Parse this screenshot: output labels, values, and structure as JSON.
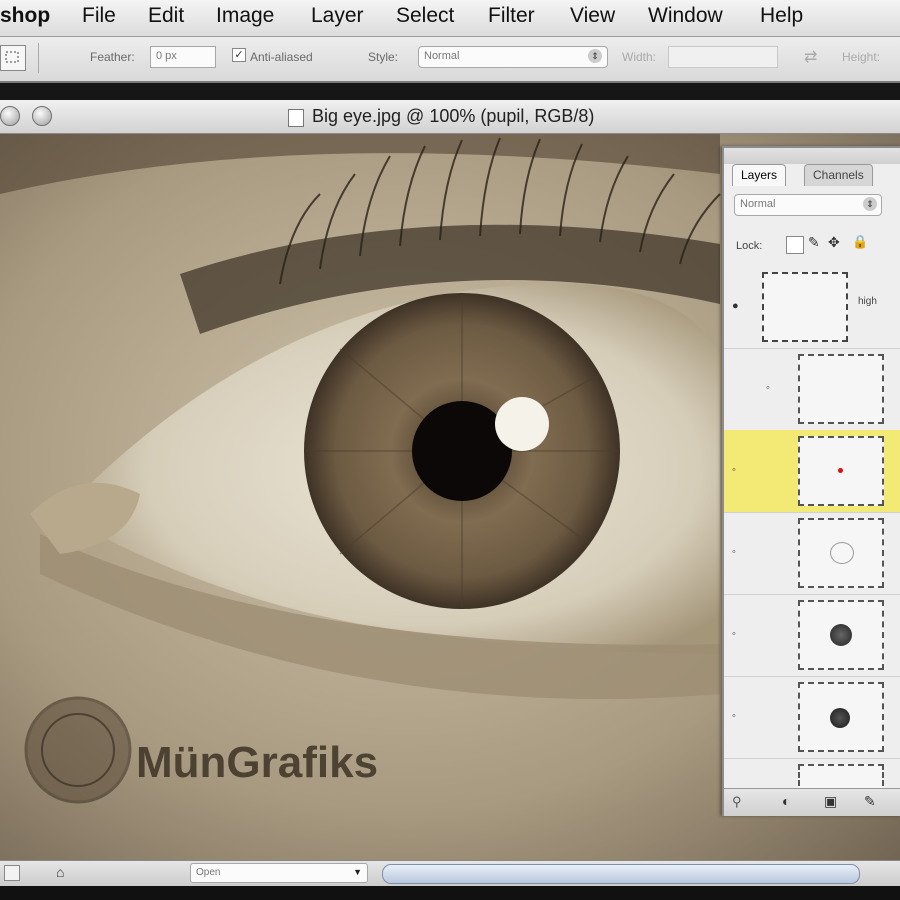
{
  "menu": {
    "app": "shop",
    "items": [
      "File",
      "Edit",
      "Image",
      "Layer",
      "Select",
      "Filter",
      "View",
      "Window",
      "Help"
    ]
  },
  "options": {
    "feather_label": "Feather:",
    "feather_value": "0 px",
    "antialiased_label": "Anti-aliased",
    "style_label": "Style:",
    "style_value": "Normal",
    "width_label": "Width:",
    "height_label": "Height:"
  },
  "document": {
    "title": "Big eye.jpg @ 100% (pupil, RGB/8)"
  },
  "watermark": {
    "text": "MünGrafiks"
  },
  "layers_panel": {
    "tabs": [
      "Layers",
      "Channels"
    ],
    "blend_mode": "Normal",
    "lock_label": "Lock:",
    "layers": [
      {
        "name": "high",
        "selected": false
      },
      {
        "name": "",
        "selected": false
      },
      {
        "name": "",
        "selected": true
      },
      {
        "name": "",
        "selected": false
      },
      {
        "name": "",
        "selected": false
      },
      {
        "name": "",
        "selected": false
      }
    ]
  },
  "status": {
    "value": "Open"
  },
  "colors": {
    "selected_layer": "#f3ea76",
    "sepia_dark": "#3b2f22",
    "sepia_light": "#e6ddcb"
  }
}
